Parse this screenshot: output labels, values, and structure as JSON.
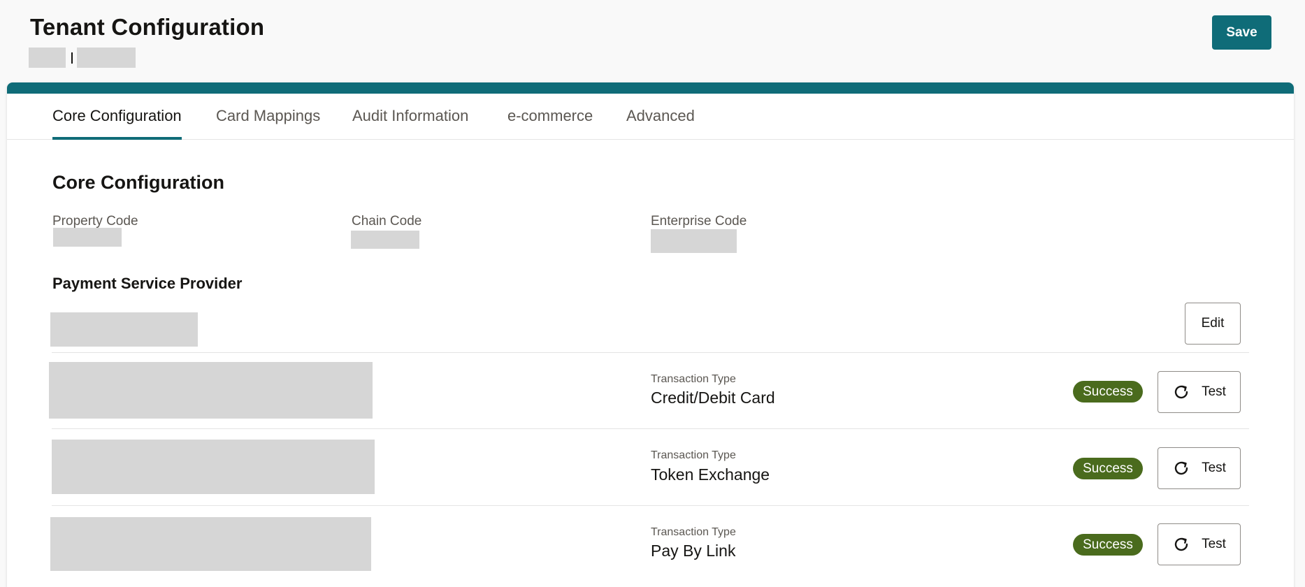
{
  "header": {
    "title": "Tenant Configuration",
    "subtitle_separator": "|"
  },
  "save_label": "Save",
  "tabs": [
    {
      "label": "Core Configuration",
      "active": true
    },
    {
      "label": "Card Mappings",
      "active": false
    },
    {
      "label": "Audit Information",
      "active": false
    },
    {
      "label": "e-commerce",
      "active": false
    },
    {
      "label": "Advanced",
      "active": false
    }
  ],
  "core": {
    "section_title": "Core Configuration",
    "fields": [
      {
        "label": "Property Code"
      },
      {
        "label": "Chain Code"
      },
      {
        "label": "Enterprise Code"
      }
    ]
  },
  "psp": {
    "title": "Payment Service Provider",
    "edit_label": "Edit",
    "rows": [
      {
        "type_label": "Transaction Type",
        "type_value": "Credit/Debit Card",
        "status": "Success",
        "test_label": "Test"
      },
      {
        "type_label": "Transaction Type",
        "type_value": "Token Exchange",
        "status": "Success",
        "test_label": "Test"
      },
      {
        "type_label": "Transaction Type",
        "type_value": "Pay By Link",
        "status": "Success",
        "test_label": "Test"
      }
    ]
  },
  "colors": {
    "accent": "#0f6c78",
    "success": "#4a6b1d",
    "redacted": "#d6d6d6"
  }
}
